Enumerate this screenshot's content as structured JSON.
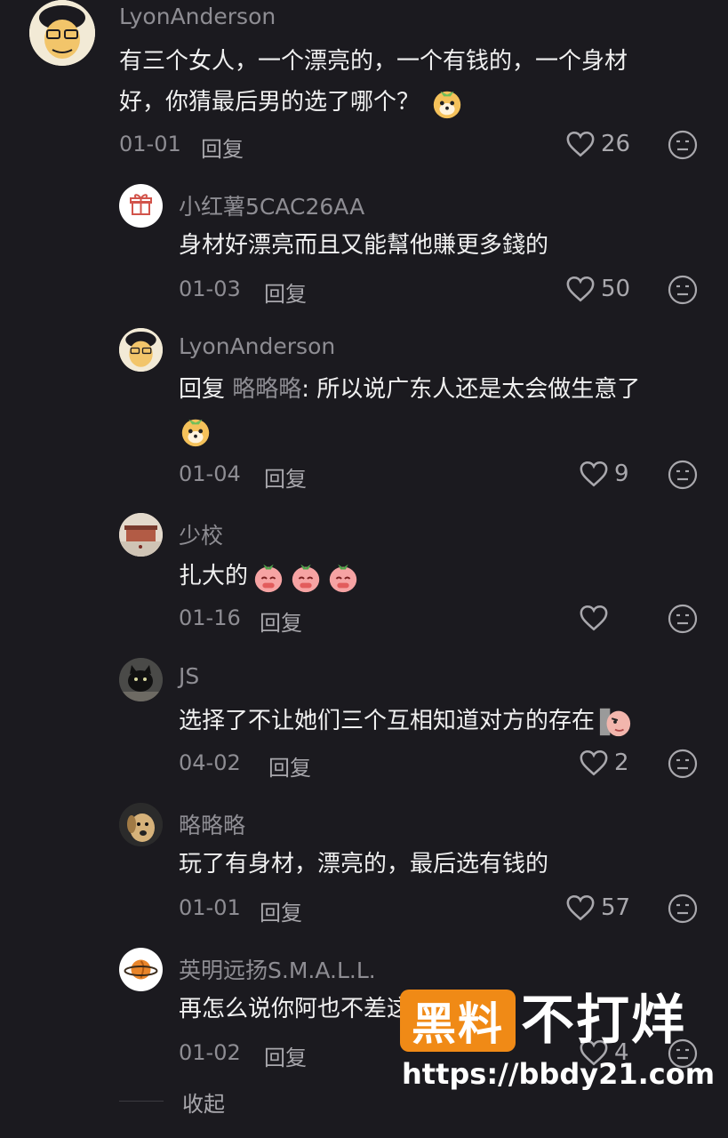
{
  "comments": [
    {
      "username": "LyonAnderson",
      "text_line1": "有三个女人，一个漂亮的，一个有钱的，一个身材",
      "text_line2": "好，你猜最后男的选了哪个？",
      "emoji": "dog-face-emoji",
      "date": "01-01",
      "reply_label": "回复",
      "likes": "26"
    }
  ],
  "replies": [
    {
      "username": "小红薯5CAC26AA",
      "text": "身材好漂亮而且又能幫他賺更多錢的",
      "date": "01-03",
      "reply_label": "回复",
      "likes": "50",
      "avatar_icon": "gift-icon"
    },
    {
      "username": "LyonAnderson",
      "reply_prefix": "回复 ",
      "mention": "略略略",
      "text": ": 所以说广东人还是太会做生意了",
      "emoji": "dog-face-emoji",
      "date": "01-04",
      "reply_label": "回复",
      "likes": "9"
    },
    {
      "username": "少校",
      "text": "扎大的",
      "emojis": [
        "pleading-face-emoji",
        "pleading-face-emoji",
        "pleading-face-emoji"
      ],
      "date": "01-16",
      "reply_label": "回复",
      "likes": ""
    },
    {
      "username": "JS",
      "text": "选择了不让她们三个互相知道对方的存在",
      "emoji": "peeking-face-emoji",
      "date": "04-02",
      "reply_label": "回复",
      "likes": "2"
    },
    {
      "username": "略略略",
      "text": "玩了有身材，漂亮的，最后选有钱的",
      "date": "01-01",
      "reply_label": "回复",
      "likes": "57"
    },
    {
      "username": "英明远扬S.M.A.L.L.",
      "text": "再怎么说你阿也不差这点钱了",
      "date": "01-02",
      "reply_label": "回复",
      "likes": "4",
      "avatar_icon": "planet-icon"
    }
  ],
  "collapse_label": "收起",
  "watermark": {
    "box_text": "黑料",
    "big_text": "不打烊",
    "url": "https://bbdy21.com"
  },
  "colors": {
    "background": "#1b1a1f",
    "text": "#f0f0f0",
    "muted": "#8e8d93",
    "watermark_orange": "#f08a16"
  }
}
